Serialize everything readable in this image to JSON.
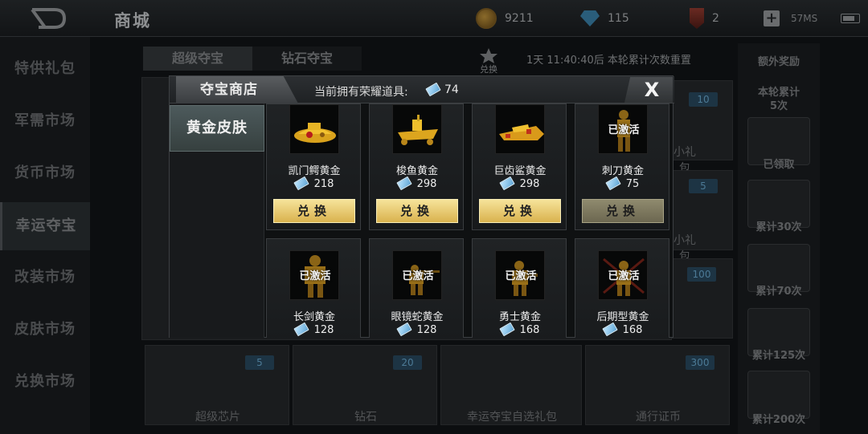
{
  "header": {
    "title": "商城",
    "coins": "9211",
    "gems": "115",
    "medals": "2",
    "ping": "57MS",
    "icons": [
      "back-icon",
      "coin-icon",
      "gem-icon",
      "medal-icon",
      "plus-icon",
      "battery-icon"
    ]
  },
  "left_nav": {
    "items": [
      {
        "label": "特供礼包"
      },
      {
        "label": "军需市场"
      },
      {
        "label": "货币市场"
      },
      {
        "label": "幸运夺宝",
        "active": true
      },
      {
        "label": "改装市场"
      },
      {
        "label": "皮肤市场"
      },
      {
        "label": "兑换市场"
      }
    ]
  },
  "background": {
    "subtabs": [
      "超级夺宝",
      "钻石夺宝"
    ],
    "exchange_label": "兑换",
    "reset_text": "1天 11:40:40后 本轮累计次数重置",
    "badges": [
      "10",
      "5",
      "100"
    ],
    "partial_labels": [
      "小礼包",
      "小礼包"
    ],
    "bottom_items": [
      {
        "label": "超级芯片",
        "badge": "5"
      },
      {
        "label": "钻石",
        "badge": "20"
      },
      {
        "label": "幸运夺宝自选礼包",
        "badge": ""
      },
      {
        "label": "通行证币",
        "badge": "300"
      }
    ],
    "right_panel": {
      "title": "额外奖励",
      "round_label": "本轮累计",
      "round_count": "5次",
      "rewards": [
        "已领取",
        "累计30次",
        "累计70次",
        "累计125次",
        "累计200次"
      ]
    }
  },
  "modal": {
    "title": "夺宝商店",
    "owned_label": "当前拥有荣耀道具:",
    "owned_value": "74",
    "close_label": "X",
    "category": "黄金皮肤",
    "redeem_label": "兑换",
    "activated_label": "已激活",
    "items": [
      {
        "name": "凯门鳄黄金",
        "price": "218",
        "kind": "boat",
        "activated": false,
        "redeem_enabled": true
      },
      {
        "name": "梭鱼黄金",
        "price": "298",
        "kind": "boat",
        "activated": false,
        "redeem_enabled": true
      },
      {
        "name": "巨齿鲨黄金",
        "price": "298",
        "kind": "boat",
        "activated": false,
        "redeem_enabled": true
      },
      {
        "name": "刺刀黄金",
        "price": "75",
        "kind": "soldier",
        "activated": true,
        "redeem_enabled": false
      },
      {
        "name": "长剑黄金",
        "price": "128",
        "kind": "soldier",
        "activated": true,
        "redeem_enabled": false
      },
      {
        "name": "眼镜蛇黄金",
        "price": "128",
        "kind": "soldier",
        "activated": true,
        "redeem_enabled": false
      },
      {
        "name": "勇士黄金",
        "price": "168",
        "kind": "soldier",
        "activated": true,
        "redeem_enabled": false
      },
      {
        "name": "后期型黄金",
        "price": "168",
        "kind": "soldier",
        "activated": true,
        "redeem_enabled": false
      }
    ]
  },
  "colors": {
    "gold_button": "#e6c566",
    "ticket": "#7fc2ee",
    "modal_bg": "#0f1112"
  }
}
